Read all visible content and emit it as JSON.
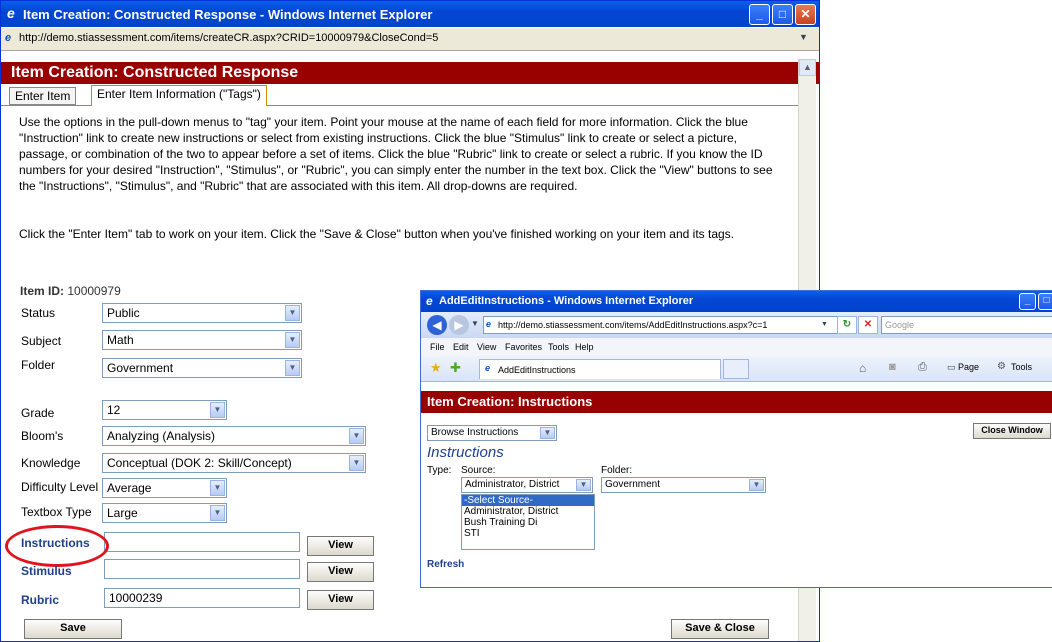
{
  "main_window": {
    "title": "Item Creation: Constructed Response - Windows Internet Explorer",
    "url": "http://demo.stiassessment.com/items/createCR.aspx?CRID=10000979&CloseCond=5",
    "header": "Item Creation: Constructed Response",
    "tabs": [
      {
        "label": "Enter Item",
        "active": false
      },
      {
        "label": "Enter Item Information (\"Tags\")",
        "active": true
      }
    ],
    "instructions_para": "Use the options in the pull-down menus to \"tag\" your item. Point your mouse at the name of each field for more information. Click the blue \"Instruction\" link to create new instructions or select from existing instructions. Click the blue \"Stimulus\" link to create or select a picture, passage, or combination of the two to appear before a set of items. Click the blue \"Rubric\" link to create or select a rubric. If you know the ID numbers for your desired \"Instruction\", \"Stimulus\", or \"Rubric\", you can simply enter the number in the text box. Click the \"View\" buttons to see the \"Instructions\", \"Stimulus\", and \"Rubric\" that are associated with this item. All drop-downs are required.",
    "save_para": "Click the \"Enter Item\" tab to work on your item. Click the \"Save & Close\" button when you've finished working on your item and its tags.",
    "item_id_label": "Item ID:",
    "item_id_value": "10000979",
    "fields": {
      "status": {
        "label": "Status",
        "value": "Public"
      },
      "subject": {
        "label": "Subject",
        "value": "Math"
      },
      "folder": {
        "label": "Folder",
        "value": "Government"
      },
      "grade": {
        "label": "Grade",
        "value": "12"
      },
      "blooms": {
        "label": "Bloom's",
        "value": "Analyzing (Analysis)"
      },
      "knowledge": {
        "label": "Knowledge",
        "value": "Conceptual (DOK 2: Skill/Concept)"
      },
      "difficulty": {
        "label": "Difficulty Level",
        "value": "Average"
      },
      "textbox": {
        "label": "Textbox Type",
        "value": "Large"
      },
      "instructions": {
        "label": "Instructions",
        "value": ""
      },
      "stimulus": {
        "label": "Stimulus",
        "value": ""
      },
      "rubric": {
        "label": "Rubric",
        "value": "10000239"
      }
    },
    "view_label": "View",
    "save_label": "Save",
    "save_close_label": "Save & Close",
    "highlight_color": "#e0141e"
  },
  "popup_window": {
    "title": "AddEditInstructions - Windows Internet Explorer",
    "url": "http://demo.stiassessment.com/items/AddEditInstructions.aspx?c=1",
    "search_placeholder": "Google",
    "menu": [
      "File",
      "Edit",
      "View",
      "Favorites",
      "Tools",
      "Help"
    ],
    "tab_title": "AddEditInstructions",
    "toolbar_page": "Page",
    "toolbar_tools": "Tools",
    "header": "Item Creation: Instructions",
    "browse_select": "Browse Instructions",
    "close_window_label": "Close Window",
    "section_title": "Instructions",
    "type_label": "Type:",
    "source_label": "Source:",
    "folder_label": "Folder:",
    "source_value": "Administrator, District",
    "folder_value": "Government",
    "source_options": [
      "-Select Source-",
      "Administrator, District",
      "Bush Training Di",
      "STI"
    ],
    "refresh_label": "Refresh"
  }
}
